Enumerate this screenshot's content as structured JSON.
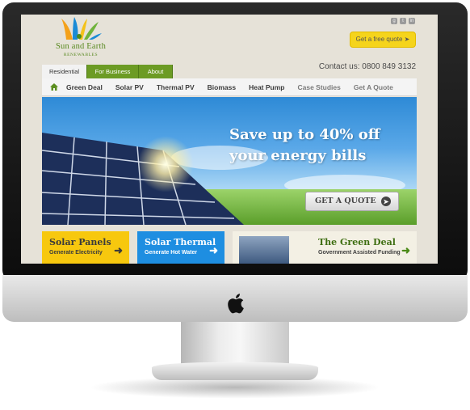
{
  "logo": {
    "name": "Sun and Earth",
    "sub": "RENEWABLES"
  },
  "header": {
    "quote_button": "Get a free quote",
    "contact": "Contact us: 0800 849 3132"
  },
  "tabs": [
    "Residential",
    "For Business",
    "About"
  ],
  "nav": [
    "Green Deal",
    "Solar PV",
    "Thermal PV",
    "Biomass",
    "Heat Pump",
    "Case Studies",
    "Get A Quote"
  ],
  "hero": {
    "title_line1": "Save up to 40% off",
    "title_line2": "your energy bills",
    "button": "GET A QUOTE"
  },
  "promos": [
    {
      "title": "Solar Panels",
      "subtitle": "Generate Electricity"
    },
    {
      "title": "Solar Thermal",
      "subtitle": "Generate Hot Water"
    },
    {
      "title": "The Green Deal",
      "subtitle": "Government Assisted Funding"
    }
  ],
  "colors": {
    "green": "#6c9b24",
    "yellow": "#f7c80e",
    "blue": "#1e8ee1"
  }
}
